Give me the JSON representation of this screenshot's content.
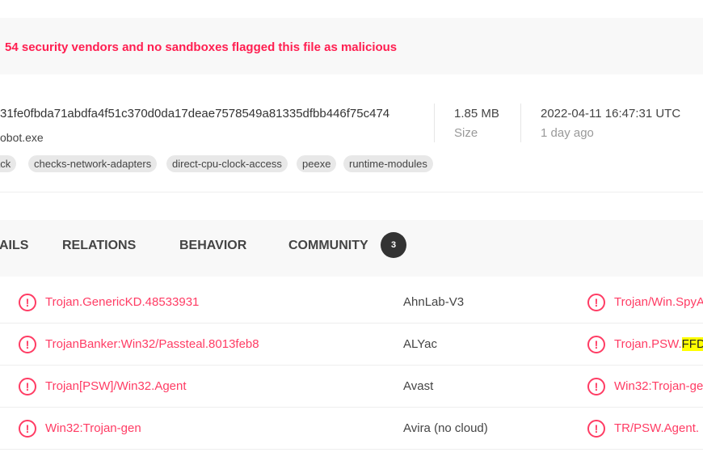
{
  "banner": {
    "text": "54 security vendors and no sandboxes flagged this file as malicious"
  },
  "file": {
    "hash": "31fe0fbda71abdfa4f51c370d0da17deae7578549a81335dfbb446f75c474",
    "name": "obot.exe",
    "tags": [
      "ack",
      "checks-network-adapters",
      "direct-cpu-clock-access",
      "peexe",
      "runtime-modules"
    ],
    "size_value": "1.85 MB",
    "size_label": "Size",
    "date_value": "2022-04-11 16:47:31 UTC",
    "date_relative": "1 day ago"
  },
  "tabs": [
    {
      "label": "AILS"
    },
    {
      "label": "RELATIONS"
    },
    {
      "label": "BEHAVIOR"
    },
    {
      "label": "COMMUNITY",
      "badge": "3"
    }
  ],
  "detections": [
    {
      "left": "Trojan.GenericKD.48533931",
      "vendor": "AhnLab-V3",
      "right": "Trojan/Win.SpyA",
      "right_hl": ""
    },
    {
      "left": "TrojanBanker:Win32/Passteal.8013feb8",
      "vendor": "ALYac",
      "right": "Trojan.PSW.",
      "right_hl": "FFD"
    },
    {
      "left": "Trojan[PSW]/Win32.Agent",
      "vendor": "Avast",
      "right": "Win32:Trojan-ge",
      "right_hl": ""
    },
    {
      "left": "Win32:Trojan-gen",
      "vendor": "Avira (no cloud)",
      "right": "TR/PSW.Agent.",
      "right_hl": ""
    }
  ],
  "icons": {
    "detection": "alert-circle-icon"
  },
  "colors": {
    "malicious": "#ff3c64",
    "banner_text": "#ff1e50",
    "highlight": "#ffff00"
  }
}
